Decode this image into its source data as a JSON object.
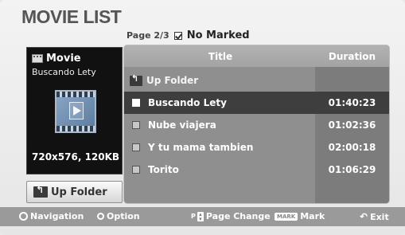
{
  "screen": {
    "title": "MOVIE LIST",
    "page": "Page 2/3",
    "marked_status": "No Marked"
  },
  "preview": {
    "type_label": "Movie",
    "name": "Buscando Lety",
    "resolution": "720x576, 120KB"
  },
  "left_button": {
    "label": "Up Folder"
  },
  "list": {
    "header_title": "Title",
    "header_duration": "Duration",
    "up_folder": "Up Folder",
    "items": [
      {
        "title": "Buscando Lety",
        "duration": "01:40:23",
        "selected": true
      },
      {
        "title": "Nube viajera",
        "duration": "01:02:36",
        "selected": false
      },
      {
        "title": "Y tu mama tambien",
        "duration": "02:00:18",
        "selected": false
      },
      {
        "title": "Torito",
        "duration": "01:06:29",
        "selected": false
      }
    ]
  },
  "bottom_bar": {
    "navigation": "Navigation",
    "option": "Option",
    "page_change_key": "P",
    "page_change": "Page Change",
    "mark_key": "MARK",
    "mark": "Mark",
    "exit": "Exit"
  }
}
